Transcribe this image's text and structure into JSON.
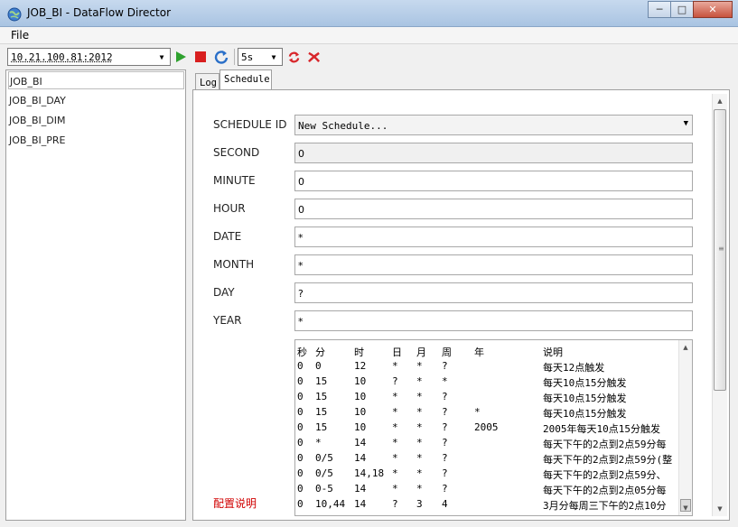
{
  "window": {
    "title": "JOB_BI - DataFlow Director"
  },
  "menu": {
    "file": "File"
  },
  "toolbar": {
    "server": "10.21.100.81:2012",
    "interval": "5s",
    "icons": [
      "play-icon",
      "stop-icon",
      "refresh-icon",
      "sync-icon",
      "close-icon"
    ]
  },
  "jobs": [
    "JOB_BI",
    "JOB_BI_DAY",
    "JOB_BI_DIM",
    "JOB_BI_PRE"
  ],
  "tabs": {
    "log": "Log",
    "schedule": "Schedule"
  },
  "form": {
    "schedule_id": {
      "label": "SCHEDULE ID",
      "value": "New Schedule..."
    },
    "second": {
      "label": "SECOND",
      "value": "0"
    },
    "minute": {
      "label": "MINUTE",
      "value": "0"
    },
    "hour": {
      "label": "HOUR",
      "value": "0"
    },
    "date": {
      "label": "DATE",
      "value": "*"
    },
    "month": {
      "label": "MONTH",
      "value": "*"
    },
    "day": {
      "label": "DAY",
      "value": "?"
    },
    "year": {
      "label": "YEAR",
      "value": "*"
    }
  },
  "help_label": "配置说明",
  "help_table": {
    "header": [
      "秒",
      "分",
      "时",
      "日",
      "月",
      "周",
      "年",
      "说明"
    ],
    "rows": [
      [
        "0",
        "0",
        "12",
        "*",
        "*",
        "?",
        "",
        "每天12点触发"
      ],
      [
        "0",
        "15",
        "10",
        "?",
        "*",
        "*",
        "",
        "每天10点15分触发"
      ],
      [
        "0",
        "15",
        "10",
        "*",
        "*",
        "?",
        "",
        "每天10点15分触发"
      ],
      [
        "0",
        "15",
        "10",
        "*",
        "*",
        "?",
        "*",
        "每天10点15分触发"
      ],
      [
        "0",
        "15",
        "10",
        "*",
        "*",
        "?",
        "2005",
        "2005年每天10点15分触发"
      ],
      [
        "0",
        "*",
        "14",
        "*",
        "*",
        "?",
        "",
        "每天下午的2点到2点59分每"
      ],
      [
        "0",
        "0/5",
        "14",
        "*",
        "*",
        "?",
        "",
        "每天下午的2点到2点59分(整"
      ],
      [
        "0",
        "0/5",
        "14,18",
        "*",
        "*",
        "?",
        "",
        "每天下午的2点到2点59分、"
      ],
      [
        "0",
        "0-5",
        "14",
        "*",
        "*",
        "?",
        "",
        "每天下午的2点到2点05分每"
      ],
      [
        "0",
        "10,44",
        "14",
        "?",
        "3",
        "4",
        "",
        "3月分每周三下午的2点10分"
      ]
    ]
  }
}
